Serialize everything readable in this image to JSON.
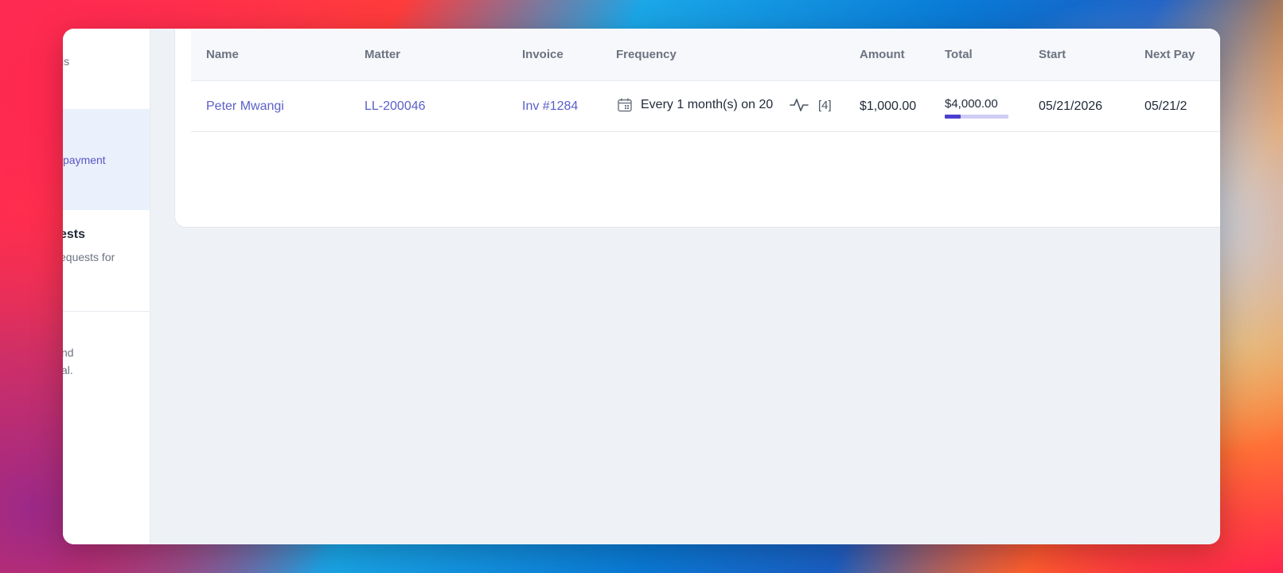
{
  "sidebar": {
    "items": [
      {
        "lines": [
          "is"
        ]
      },
      {
        "lines": [
          "payment"
        ],
        "active": true
      },
      {
        "title": "ests",
        "lines": [
          "equests for"
        ]
      },
      {
        "lines": [
          "nd",
          "al."
        ]
      }
    ]
  },
  "table": {
    "columns": [
      "Name",
      "Matter",
      "Invoice",
      "Frequency",
      "Amount",
      "Total",
      "Start",
      "Next Pay"
    ],
    "rows": [
      {
        "name": "Peter Mwangi",
        "matter": "LL-200046",
        "invoice": "Inv #1284",
        "frequency": "Every 1 month(s) on 20",
        "payments_count": "[4]",
        "amount": "$1,000.00",
        "total": "$4,000.00",
        "total_progress": 0.25,
        "start": "05/21/2026",
        "next_payment": "05/21/2"
      }
    ]
  },
  "icons": {
    "frequency": "calendar-icon",
    "activity": "activity-pulse-icon"
  },
  "colors": {
    "accent": "#5b5fc7",
    "progress_fill": "#4b3fcf",
    "progress_track": "#cfcdf3",
    "active_sidebar": "#eaf0fc"
  }
}
